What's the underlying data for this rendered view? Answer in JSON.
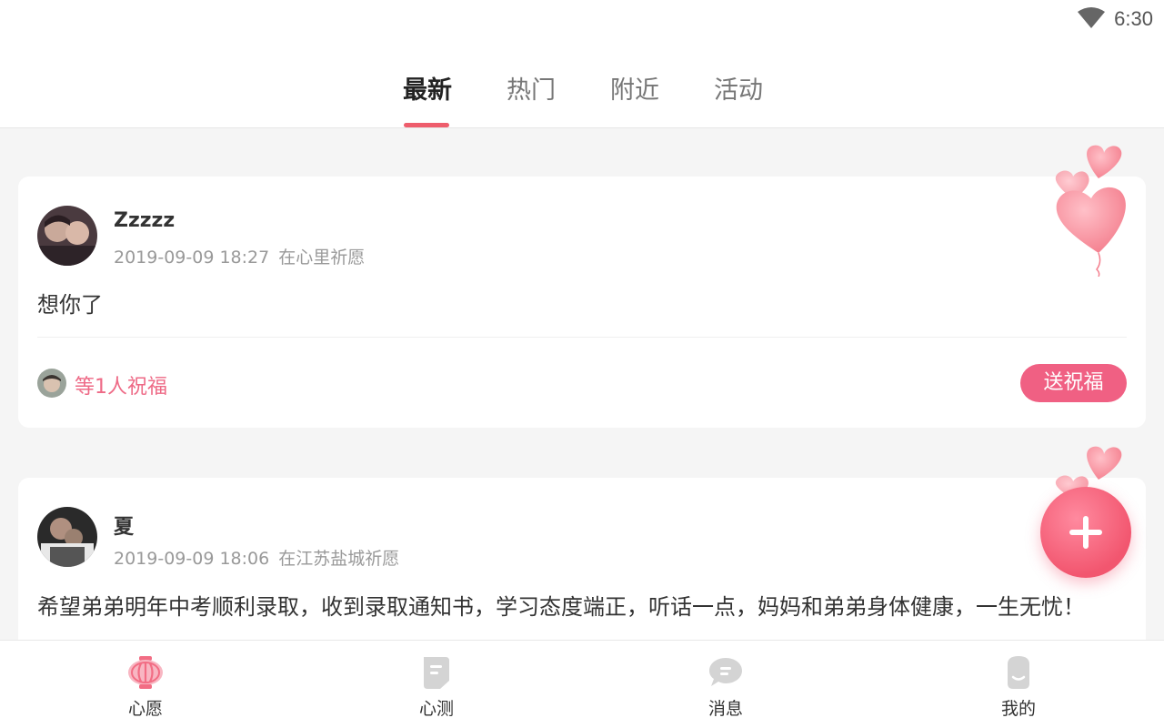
{
  "status_bar": {
    "time": "6:30"
  },
  "tabs": [
    {
      "label": "最新",
      "active": true
    },
    {
      "label": "热门",
      "active": false
    },
    {
      "label": "附近",
      "active": false
    },
    {
      "label": "活动",
      "active": false
    }
  ],
  "posts": [
    {
      "username": "Zzzzz",
      "datetime": "2019-09-09 18:27",
      "location": "在心里祈愿",
      "content": "想你了",
      "bless_text": "等1人祝福",
      "bless_button": "送祝福"
    },
    {
      "username": "夏",
      "datetime": "2019-09-09 18:06",
      "location": "在江苏盐城祈愿",
      "content": "希望弟弟明年中考顺利录取，收到录取通知书，学习态度端正，听话一点，妈妈和弟弟身体健康，一生无忧！"
    }
  ],
  "fab": {
    "icon": "plus-icon"
  },
  "bottom_nav": [
    {
      "label": "心愿",
      "icon": "lantern-icon",
      "active": true
    },
    {
      "label": "心测",
      "icon": "document-icon",
      "active": false
    },
    {
      "label": "消息",
      "icon": "chat-bubble-icon",
      "active": false
    },
    {
      "label": "我的",
      "icon": "profile-face-icon",
      "active": false
    }
  ],
  "colors": {
    "accent": "#ee5d6c",
    "bless": "#ee6a86",
    "button": "#f06083",
    "inactive_icon": "#d4d4d4"
  }
}
